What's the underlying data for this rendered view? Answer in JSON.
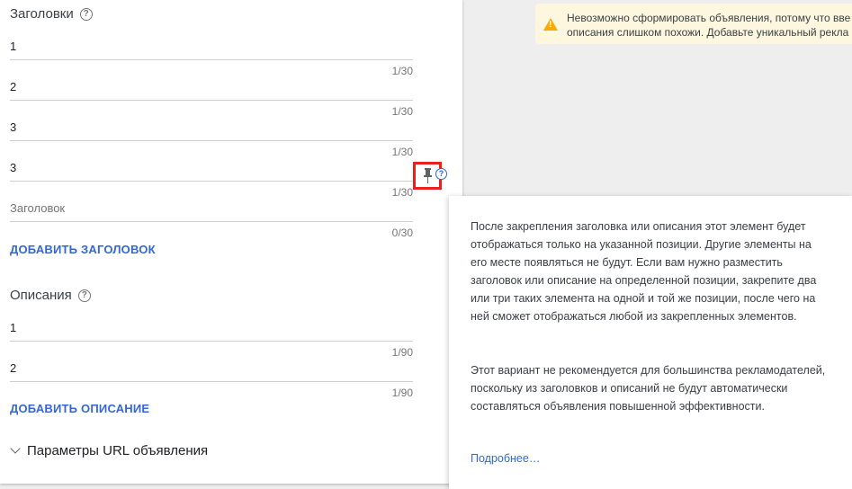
{
  "headlines": {
    "title": "Заголовки",
    "fields": [
      {
        "value": "1",
        "count": "1/30"
      },
      {
        "value": "2",
        "count": "1/30"
      },
      {
        "value": "3",
        "count": "1/30"
      },
      {
        "value": "3",
        "count": "1/30"
      }
    ],
    "empty_field": {
      "placeholder": "Заголовок",
      "count": "0/30"
    },
    "add_label": "ДОБАВИТЬ ЗАГОЛОВОК"
  },
  "descriptions": {
    "title": "Описания",
    "fields": [
      {
        "value": "1",
        "count": "1/90"
      },
      {
        "value": "2",
        "count": "1/90"
      }
    ],
    "add_label": "ДОБАВИТЬ ОПИСАНИЕ"
  },
  "url_params": {
    "label": "Параметры URL объявления"
  },
  "warning": {
    "line1": "Невозможно сформировать объявления, потому что вве",
    "line2": "описания слишком похожи. Добавьте уникальный рекла"
  },
  "tooltip": {
    "paragraph1": "После закрепления заголовка или описания этот элемент будет отображаться только на указанной позиции. Другие элементы на его месте появляться не будут. Если вам нужно разместить заголовок или описание на определенной позиции, закрепите два или три таких элемента на одной и той же позиции, после чего на ней сможет отображаться любой из закрепленных элементов.",
    "paragraph2": "Этот вариант не рекомендуется для большинства рекламодателей, поскольку из заголовков и описаний не будут автоматически составляться объявления повышенной эффективности.",
    "link": "Подробнее…"
  },
  "colors": {
    "accent": "#3367d6",
    "highlight": "#e8201f",
    "warning_bg": "#fef7e0",
    "warning_icon": "#f9ab00"
  }
}
